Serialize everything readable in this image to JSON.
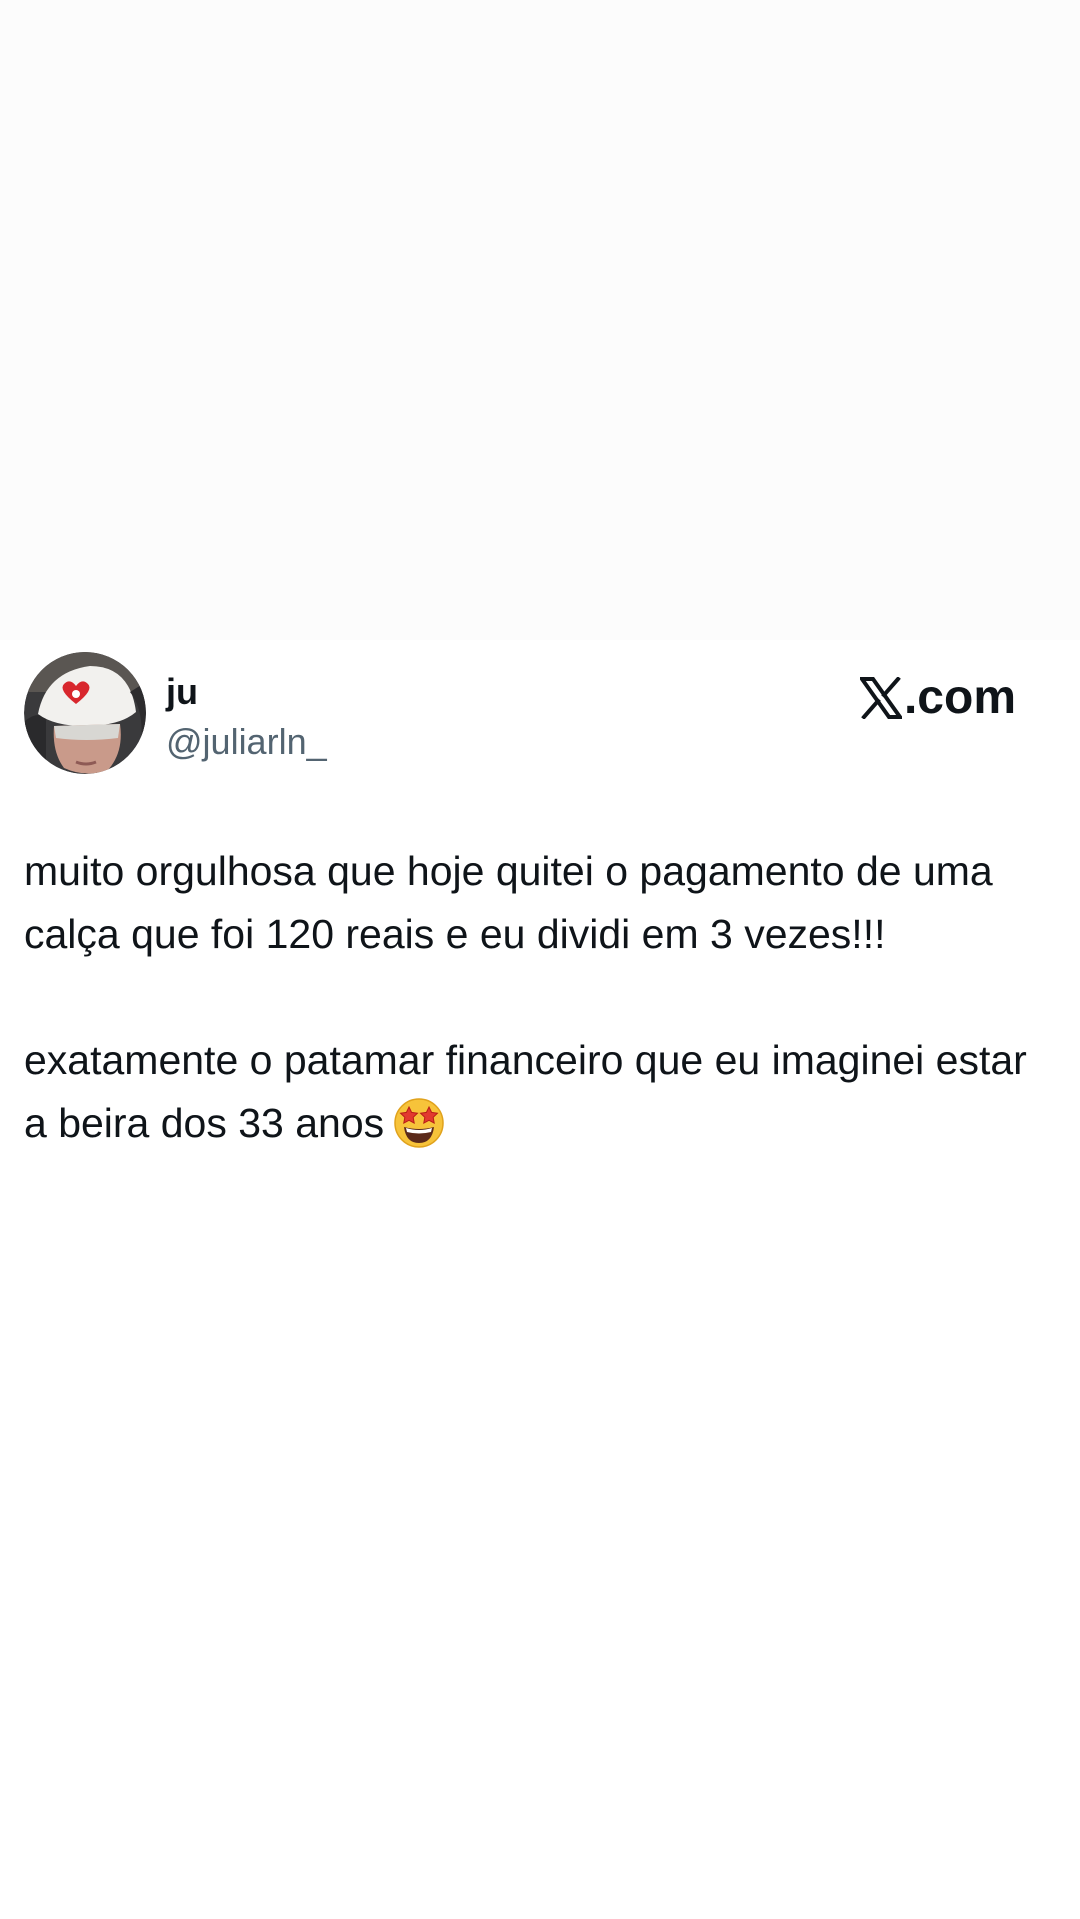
{
  "tweet": {
    "author": {
      "display_name": "ju",
      "handle": "@juliarln_",
      "avatar_icon": "profile-photo-avatar"
    },
    "brand": {
      "icon": "x-logo-icon",
      "suffix": ".com"
    },
    "paragraphs": [
      "muito orgulhosa que hoje quitei o pagamento de uma calça que foi 120 reais e eu dividi em 3 vezes!!!",
      "exatamente o patamar financeiro que eu imaginei estar a beira dos 33 anos"
    ],
    "emoji": "star-struck-emoji-icon"
  },
  "colors": {
    "text_primary": "#0f1419",
    "text_secondary": "#536471",
    "background": "#ffffff"
  }
}
